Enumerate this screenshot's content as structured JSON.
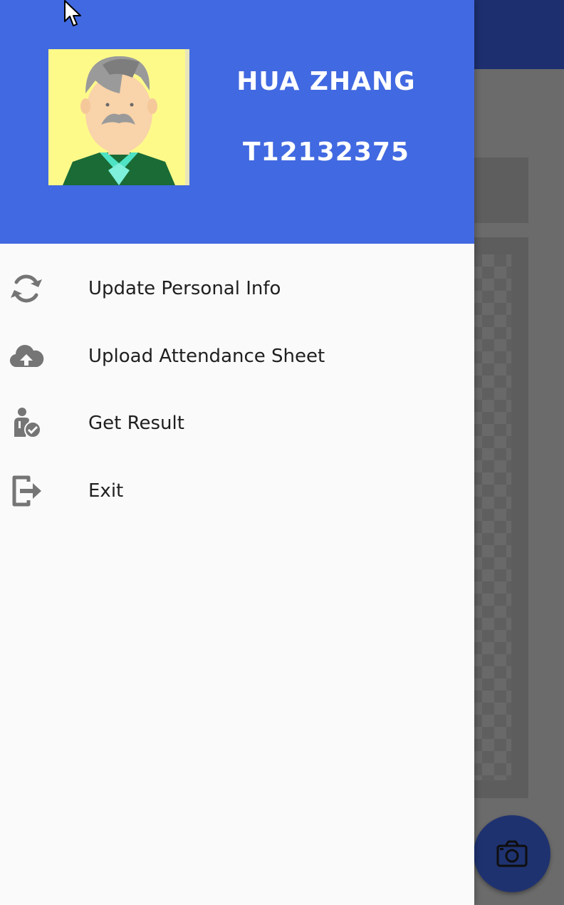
{
  "header": {
    "user_name": "Hua Zhang",
    "user_id": "T12132375",
    "background_color": "#4169e1"
  },
  "menu": {
    "items": [
      {
        "label": "Update Personal Info",
        "icon": "sync-icon"
      },
      {
        "label": "Upload Attendance Sheet",
        "icon": "cloud-upload-icon"
      },
      {
        "label": "Get Result",
        "icon": "user-check-icon"
      },
      {
        "label": "Exit",
        "icon": "exit-icon"
      }
    ]
  },
  "fab": {
    "icon": "camera-icon"
  },
  "colors": {
    "drawer_background": "#fafafa",
    "menu_icon": "#757575",
    "menu_text": "#1f1f1f",
    "app_bar": "#1d2f6f",
    "fab": "#1f3270"
  }
}
